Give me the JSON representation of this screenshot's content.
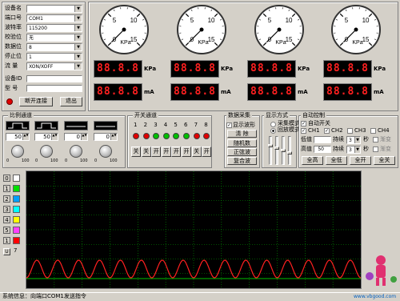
{
  "device": {
    "fields": [
      {
        "label": "设备名",
        "value": ""
      },
      {
        "label": "端口号",
        "value": "COM1"
      },
      {
        "label": "波特率",
        "value": "115200"
      },
      {
        "label": "校验位",
        "value": "无"
      },
      {
        "label": "数据位",
        "value": "8"
      },
      {
        "label": "停止位",
        "value": "1"
      },
      {
        "label": "流  量",
        "value": "XON/XOFF"
      }
    ],
    "id_label": "设备ID",
    "model_label": "型  号",
    "disconnect_button": "断开连接",
    "exit_button": "退出",
    "status_color": "#e00000"
  },
  "gauges": {
    "unit": "KPa",
    "ticks": [
      "0",
      "5",
      "10",
      "15"
    ],
    "count": 4
  },
  "displays": {
    "pressure_values": [
      "88.8.8",
      "88.8.8",
      "88.8.8",
      "88.8.8"
    ],
    "pressure_unit": "KPa",
    "current_values": [
      "88.8.8",
      "88.8.8",
      "88.8.8",
      "88.8.8"
    ],
    "current_unit": "mA"
  },
  "proportional": {
    "title": "比例通道",
    "spinners": [
      "50",
      "50",
      "0",
      "0"
    ],
    "knob_labels": [
      "0",
      "100"
    ]
  },
  "switches": {
    "title": "开关通道",
    "numbers": [
      "1",
      "2",
      "3",
      "4",
      "5",
      "6",
      "7",
      "8"
    ],
    "led_colors": [
      "#e00000",
      "#e00000",
      "#00c000",
      "#00c000",
      "#00c000",
      "#00c000",
      "#e00000",
      "#e00000"
    ],
    "buttons": [
      "关",
      "关",
      "开",
      "开",
      "开",
      "开",
      "关",
      "开"
    ]
  },
  "acquisition": {
    "title": "数据采集",
    "show_waveform": "显示波形",
    "clear_button": "清  除",
    "random_button": "随机数",
    "sine_button": "正弦波",
    "composite_button": "复合波"
  },
  "display_mode": {
    "title": "显示方式",
    "acq_mode": "采集模式",
    "playback_mode": "回放模式"
  },
  "auto_control": {
    "title": "自动控制",
    "auto_switch": "自动开关",
    "channels": [
      "CH1",
      "CH2",
      "CH3",
      "CH4"
    ],
    "low_label": "低值",
    "high_label": "高值",
    "low_value": "",
    "high_value": "50",
    "duration_label": "持续",
    "duration_low": "3",
    "duration_high": "3",
    "seconds_label": "秒",
    "hint": "渐变",
    "buttons": [
      "全高",
      "全低",
      "全开",
      "全关"
    ]
  },
  "channel_legend": [
    {
      "num": "0",
      "color": "#ffffff"
    },
    {
      "num": "1",
      "color": "#00e000"
    },
    {
      "num": "2",
      "color": "#00a0ff"
    },
    {
      "num": "3",
      "color": "#00ffff"
    },
    {
      "num": "4",
      "color": "#ffff00"
    },
    {
      "num": "5",
      "color": "#ff40ff"
    },
    {
      "num": "1",
      "color": "#ff0000"
    }
  ],
  "legend_extra": "7",
  "legend_button": "U",
  "status_bar": {
    "text": "系统信息：向端口COM1发送指令"
  },
  "watermark": "www.vbgood.com",
  "colors": {
    "waveform": "#ff2020",
    "plot_bg": "#000000",
    "grid": "#00a000"
  }
}
